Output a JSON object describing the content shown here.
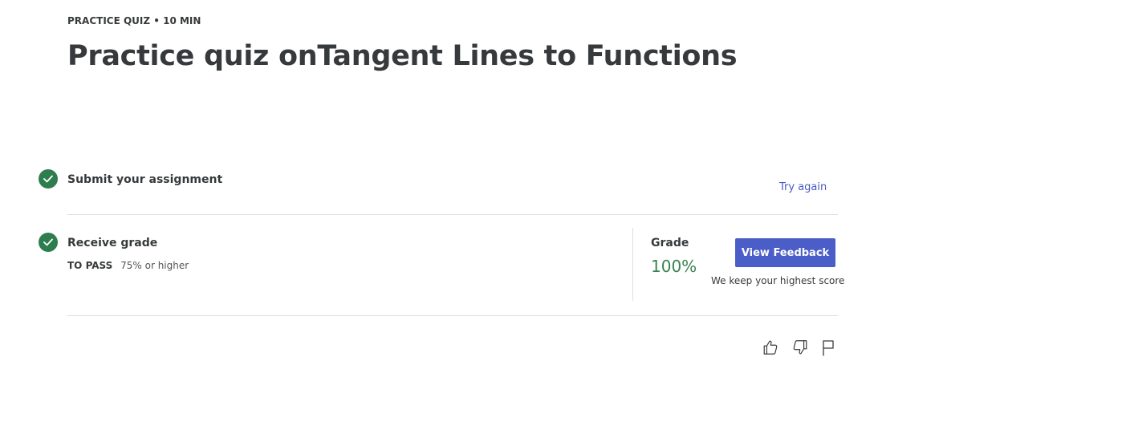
{
  "header": {
    "eyebrow": "PRACTICE QUIZ • 10 MIN",
    "title": "Practice quiz onTangent Lines to Functions"
  },
  "steps": [
    {
      "label": "Submit your assignment",
      "status_icon": "check-circle-icon"
    },
    {
      "label": "Receive grade",
      "status_icon": "check-circle-icon"
    }
  ],
  "submit": {
    "try_again_label": "Try again"
  },
  "requirement": {
    "label": "TO PASS",
    "value": "75% or higher"
  },
  "grade": {
    "label": "Grade",
    "value": "100%",
    "view_feedback_label": "View Feedback",
    "note": "We keep your highest score"
  },
  "feedback_icons": [
    "thumbs-up-icon",
    "thumbs-down-icon",
    "flag-icon"
  ],
  "colors": {
    "accent": "#4b5dc7",
    "success": "#2e7d4f",
    "grade_text": "#3b8250",
    "text": "#373a3c"
  }
}
